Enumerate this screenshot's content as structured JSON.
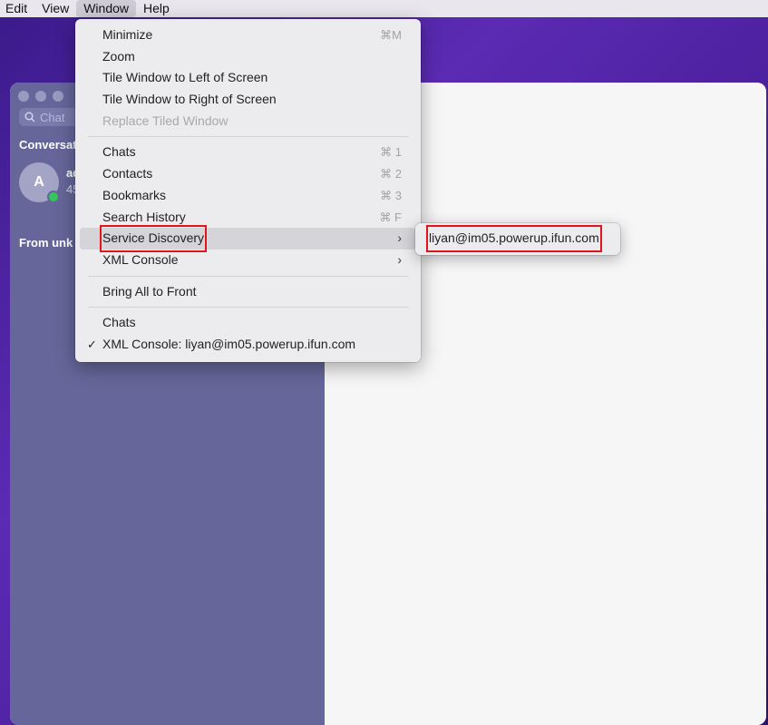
{
  "menubar": {
    "items": [
      "Edit",
      "View",
      "Window",
      "Help"
    ],
    "active": "Window"
  },
  "window_menu": {
    "items": [
      {
        "label": "Minimize",
        "shortcut": "⌘M"
      },
      {
        "label": "Zoom",
        "shortcut": ""
      },
      {
        "label": "Tile Window to Left of Screen",
        "shortcut": ""
      },
      {
        "label": "Tile Window to Right of Screen",
        "shortcut": ""
      },
      {
        "label": "Replace Tiled Window",
        "shortcut": ""
      },
      {
        "label": "Chats",
        "shortcut": "⌘ 1"
      },
      {
        "label": "Contacts",
        "shortcut": "⌘ 2"
      },
      {
        "label": "Bookmarks",
        "shortcut": "⌘ 3"
      },
      {
        "label": "Search History",
        "shortcut": "⌘ F"
      },
      {
        "label": "Service Discovery",
        "shortcut": "›"
      },
      {
        "label": "XML Console",
        "shortcut": "›"
      },
      {
        "label": "Bring All to Front",
        "shortcut": ""
      },
      {
        "label": "Chats",
        "shortcut": ""
      },
      {
        "label": "XML Console: liyan@im05.powerup.ifun.com",
        "shortcut": "",
        "check": "✓"
      }
    ]
  },
  "submenu": {
    "item": "liyan@im05.powerup.ifun.com"
  },
  "sidebar": {
    "search_placeholder": "Chat",
    "section_title": "Conversat",
    "conversation": {
      "avatar": "A",
      "name": "ad",
      "subtitle": "45"
    },
    "from_unknown": "From unk"
  },
  "colors": {
    "highlight_outline": "#e0151b",
    "sidebar": "#66669a",
    "presence": "#35c759"
  }
}
